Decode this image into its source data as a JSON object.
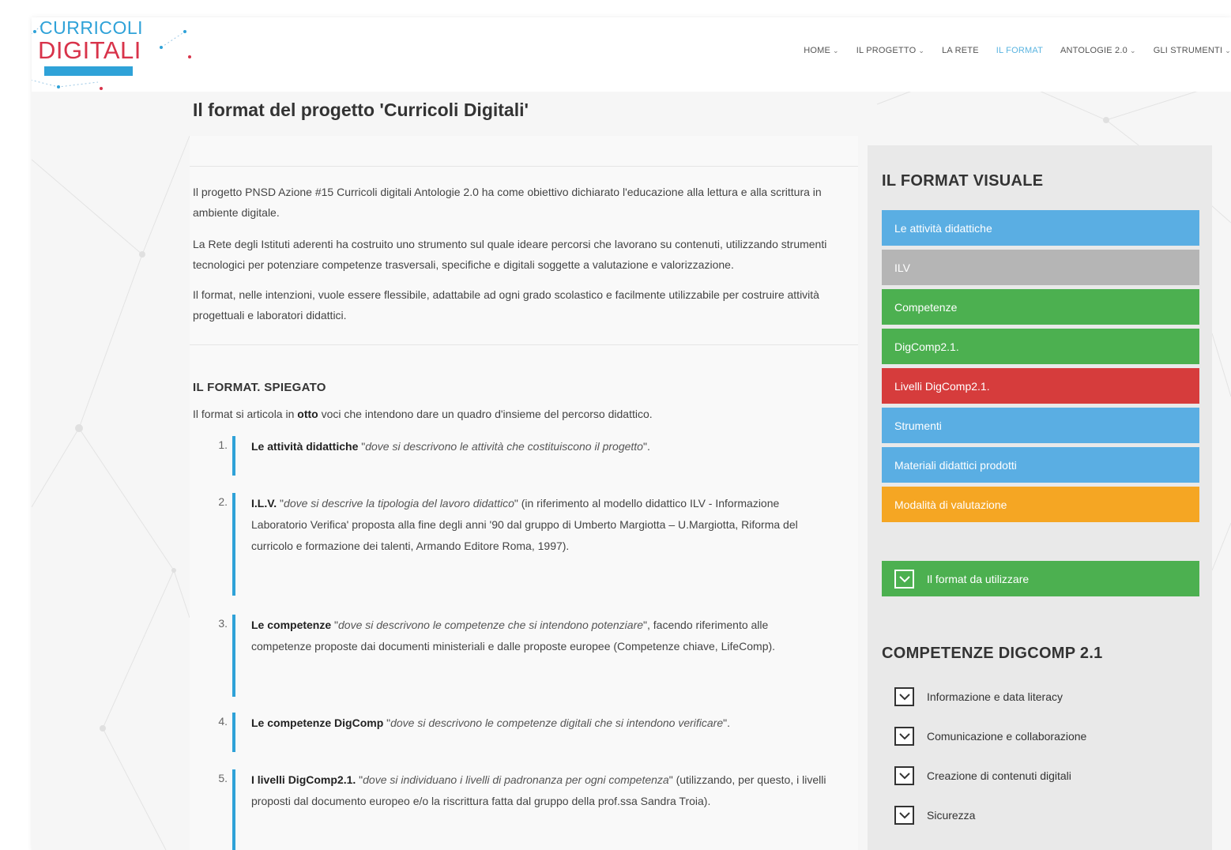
{
  "logo": {
    "line1": "CURRICOLI",
    "line2": "DIGITALI"
  },
  "nav": [
    {
      "label": "HOME",
      "dropdown": true,
      "active": false
    },
    {
      "label": "IL PROGETTO",
      "dropdown": true,
      "active": false
    },
    {
      "label": "LA RETE",
      "dropdown": false,
      "active": false
    },
    {
      "label": "IL FORMAT",
      "dropdown": false,
      "active": true
    },
    {
      "label": "ANTOLOGIE 2.0",
      "dropdown": true,
      "active": false
    },
    {
      "label": "GLI STRUMENTI",
      "dropdown": true,
      "active": false
    }
  ],
  "page": {
    "title": "Il format del progetto 'Curricoli Digitali'",
    "paragraphs": [
      "Il progetto PNSD Azione #15 Curricoli digitali Antologie 2.0 ha come obiettivo dichiarato l'educazione alla lettura e alla scrittura in ambiente digitale.",
      "La Rete degli Istituti aderenti ha costruito uno strumento sul quale ideare percorsi che lavorano su contenuti, utilizzando strumenti tecnologici per potenziare competenze trasversali, specifiche e digitali soggette a valutazione e valorizzazione.",
      "Il format, nelle intenzioni, vuole essere flessibile, adattabile ad ogni grado scolastico e facilmente utilizzabile per costruire attività progettuali e laboratori didattici."
    ],
    "section_heading": "IL FORMAT. SPIEGATO",
    "intro": {
      "before": "Il format si articola in ",
      "bold": "otto",
      "after": " voci che intendono dare un quadro d'insieme del percorso didattico."
    },
    "items": [
      {
        "num": "1.",
        "bold": "Le attività didattiche",
        "pre": " \"",
        "italic": "dove si descrivono le attività che costituiscono il progetto",
        "post": "\"."
      },
      {
        "num": "2.",
        "bold": "I.L.V.",
        "pre": " \"",
        "italic": "dove si descrive la tipologia del lavoro didattico",
        "post": "\" (in riferimento al modello didattico ILV - Informazione Laboratorio Verifica' proposta alla fine degli anni '90 dal gruppo di Umberto Margiotta – U.Margiotta, Riforma del curricolo e formazione dei talenti, Armando Editore Roma, 1997)."
      },
      {
        "num": "3.",
        "bold": "Le competenze",
        "pre": " \"",
        "italic": "dove si descrivono le competenze che si intendono potenziare",
        "post": "\", facendo riferimento alle competenze proposte dai documenti ministeriali e dalle proposte europee (Competenze chiave, LifeComp)."
      },
      {
        "num": "4.",
        "bold": "Le competenze DigComp",
        "pre": " \"",
        "italic": "dove si descrivono le competenze digitali che si intendono verificare",
        "post": "\"."
      },
      {
        "num": "5.",
        "bold": "I livelli DigComp2.1.",
        "pre": " \"",
        "italic": "dove si individuano i livelli di padronanza per ogni competenza",
        "post": "\" (utilizzando, per questo, i livelli proposti dal documento europeo e/o la riscrittura fatta dal gruppo della prof.ssa Sandra Troia)."
      }
    ]
  },
  "sidebar": {
    "format_title": "IL FORMAT VISUALE",
    "format_buttons": [
      {
        "label": "Le attività didattiche",
        "color": "#5aaee3"
      },
      {
        "label": "ILV",
        "color": "#b5b5b5"
      },
      {
        "label": "Competenze",
        "color": "#4cb050"
      },
      {
        "label": "DigComp2.1.",
        "color": "#4cb050"
      },
      {
        "label": "Livelli DigComp2.1.",
        "color": "#d63c3c"
      },
      {
        "label": "Strumenti",
        "color": "#5aaee3"
      },
      {
        "label": "Materiali didattici prodotti",
        "color": "#5aaee3"
      },
      {
        "label": "Modalità di valutazione",
        "color": "#f5a623"
      }
    ],
    "use_button": "Il format da utilizzare",
    "competenze_title": "COMPETENZE DIGCOMP 2.1",
    "competenze": [
      "Informazione e data literacy",
      "Comunicazione e collaborazione",
      "Creazione di contenuti digitali",
      "Sicurezza"
    ]
  }
}
